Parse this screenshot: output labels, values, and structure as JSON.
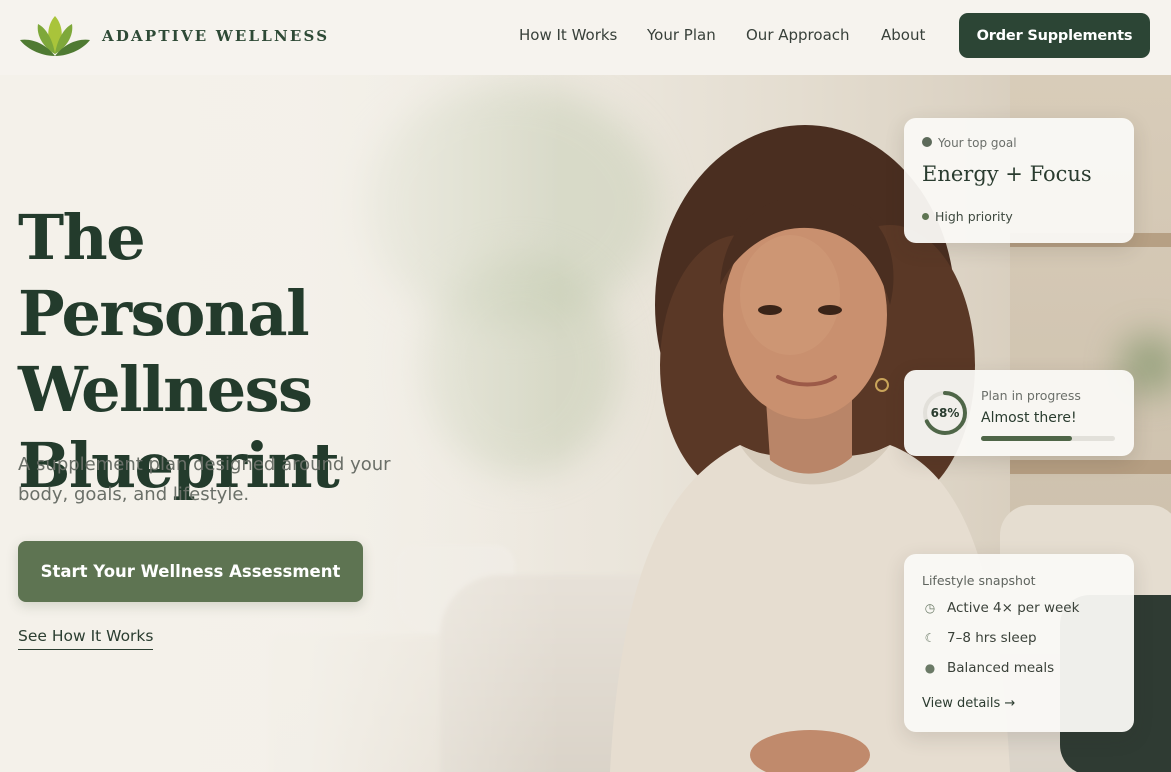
{
  "brand": {
    "name": "ADAPTIVE WELLNESS",
    "logo_icon": "lotus-leaf-logo"
  },
  "nav": {
    "items": [
      {
        "label": "How It Works"
      },
      {
        "label": "Your Plan"
      },
      {
        "label": "Our Approach"
      },
      {
        "label": "About"
      }
    ],
    "order_button": "Order Supplements"
  },
  "hero": {
    "title": "The Personal Wellness Blueprint",
    "subtitle": "A supplement plan designed around your body, goals, and lifestyle.",
    "cta_label": "Start Your Wellness Assessment",
    "secondary_link": "See How It Works"
  },
  "goal_card": {
    "label": "Your top goal",
    "title": "Energy + Focus",
    "priority": "High priority",
    "icon": "target-icon"
  },
  "progress_card": {
    "percent_text": "68%",
    "progress": 0.68,
    "label": "Plan in progress",
    "title": "Almost there!"
  },
  "lifestyle_card": {
    "title": "Lifestyle snapshot",
    "items": [
      {
        "icon": "clock-icon",
        "text": "Active 4× per week"
      },
      {
        "icon": "moon-icon",
        "text": "7–8 hrs sleep"
      },
      {
        "icon": "plate-icon",
        "text": "Balanced meals"
      }
    ],
    "link": "View details →"
  },
  "colors": {
    "primary_dark": "#2c4535",
    "primary_green": "#5e7452",
    "heading": "#233b2c",
    "background": "#f4f1ea"
  }
}
